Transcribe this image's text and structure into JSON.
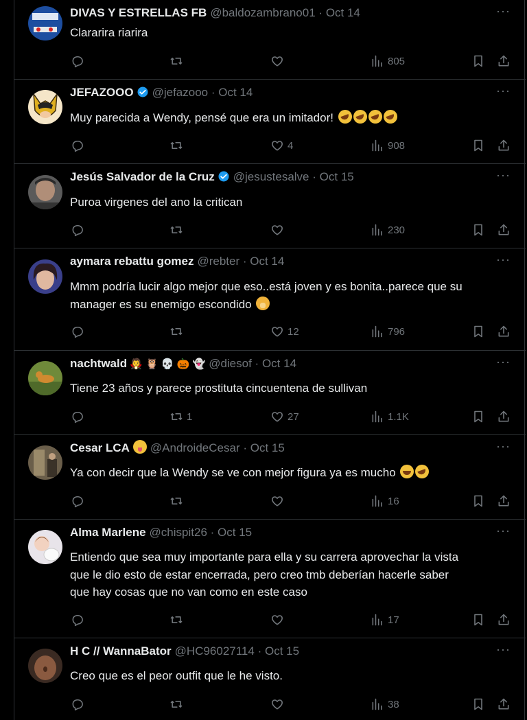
{
  "tweets": [
    {
      "name": "DIVAS Y ESTRELLAS FB",
      "handle": "@baldozambrano01",
      "date": "Oct 14",
      "text": "Clararira riarira",
      "text2": "",
      "replies": "",
      "retweets": "",
      "likes": "",
      "views": "805"
    },
    {
      "name": "JEFAZOOO",
      "handle": "@jefazooo",
      "date": "Oct 14",
      "text": "Muy parecida a Wendy, pensé que era un imitador!",
      "text2": "",
      "replies": "",
      "retweets": "",
      "likes": "4",
      "views": "908"
    },
    {
      "name": "Jesús Salvador de la Cruz",
      "handle": "@jesustesalve",
      "date": "Oct 15",
      "text": "Puroa virgenes del ano la critican",
      "text2": "",
      "replies": "",
      "retweets": "",
      "likes": "",
      "views": "230"
    },
    {
      "name": "aymara rebattu gomez",
      "handle": "@rebter",
      "date": "Oct 14",
      "text": "Mmm podría lucir algo mejor que eso..está joven y es bonita..parece que su",
      "text2": "manager es su enemigo escondido",
      "replies": "",
      "retweets": "",
      "likes": "12",
      "views": "796"
    },
    {
      "name": "nachtwald",
      "name_emojis": "🧛 🦉 💀 🎃 👻",
      "handle": "@diesof",
      "date": "Oct 14",
      "text": "Tiene 23 años y parece prostituta cincuentena de sullivan",
      "text2": "",
      "replies": "",
      "retweets": "1",
      "likes": "27",
      "views": "1.1K"
    },
    {
      "name": "Cesar LCA",
      "handle": "@AndroideCesar",
      "date": "Oct 15",
      "text": "Ya con decir que la Wendy se ve con mejor figura ya es mucho",
      "text2": "",
      "replies": "",
      "retweets": "",
      "likes": "",
      "views": "16"
    },
    {
      "name": "Alma Marlene",
      "handle": "@chispit26",
      "date": "Oct 15",
      "text": "Entiendo que sea muy importante para ella y su carrera aprovechar la vista",
      "text2": "que le dio esto de estar encerrada, pero creo tmb deberían hacerle saber",
      "text3": "que hay cosas que no van como en este caso",
      "replies": "",
      "retweets": "",
      "likes": "",
      "views": "17"
    },
    {
      "name": "H C // WannaBator",
      "handle": "@HC96027114",
      "date": "Oct 15",
      "text": "Creo que es el peor outfit que le he visto.",
      "text2": "",
      "replies": "",
      "retweets": "",
      "likes": "",
      "views": "38"
    }
  ],
  "date_separator": "·",
  "more_label": "···",
  "icons": {
    "reply": "reply-icon",
    "retweet": "retweet-icon",
    "like": "heart-icon",
    "views": "views-icon",
    "bookmark": "bookmark-icon",
    "share": "share-icon",
    "verified": "verified-badge-icon"
  },
  "colors": {
    "background": "#000000",
    "text": "#e7e9ea",
    "muted": "#71767b",
    "border": "#2f3336",
    "verified": "#1d9bf0"
  }
}
